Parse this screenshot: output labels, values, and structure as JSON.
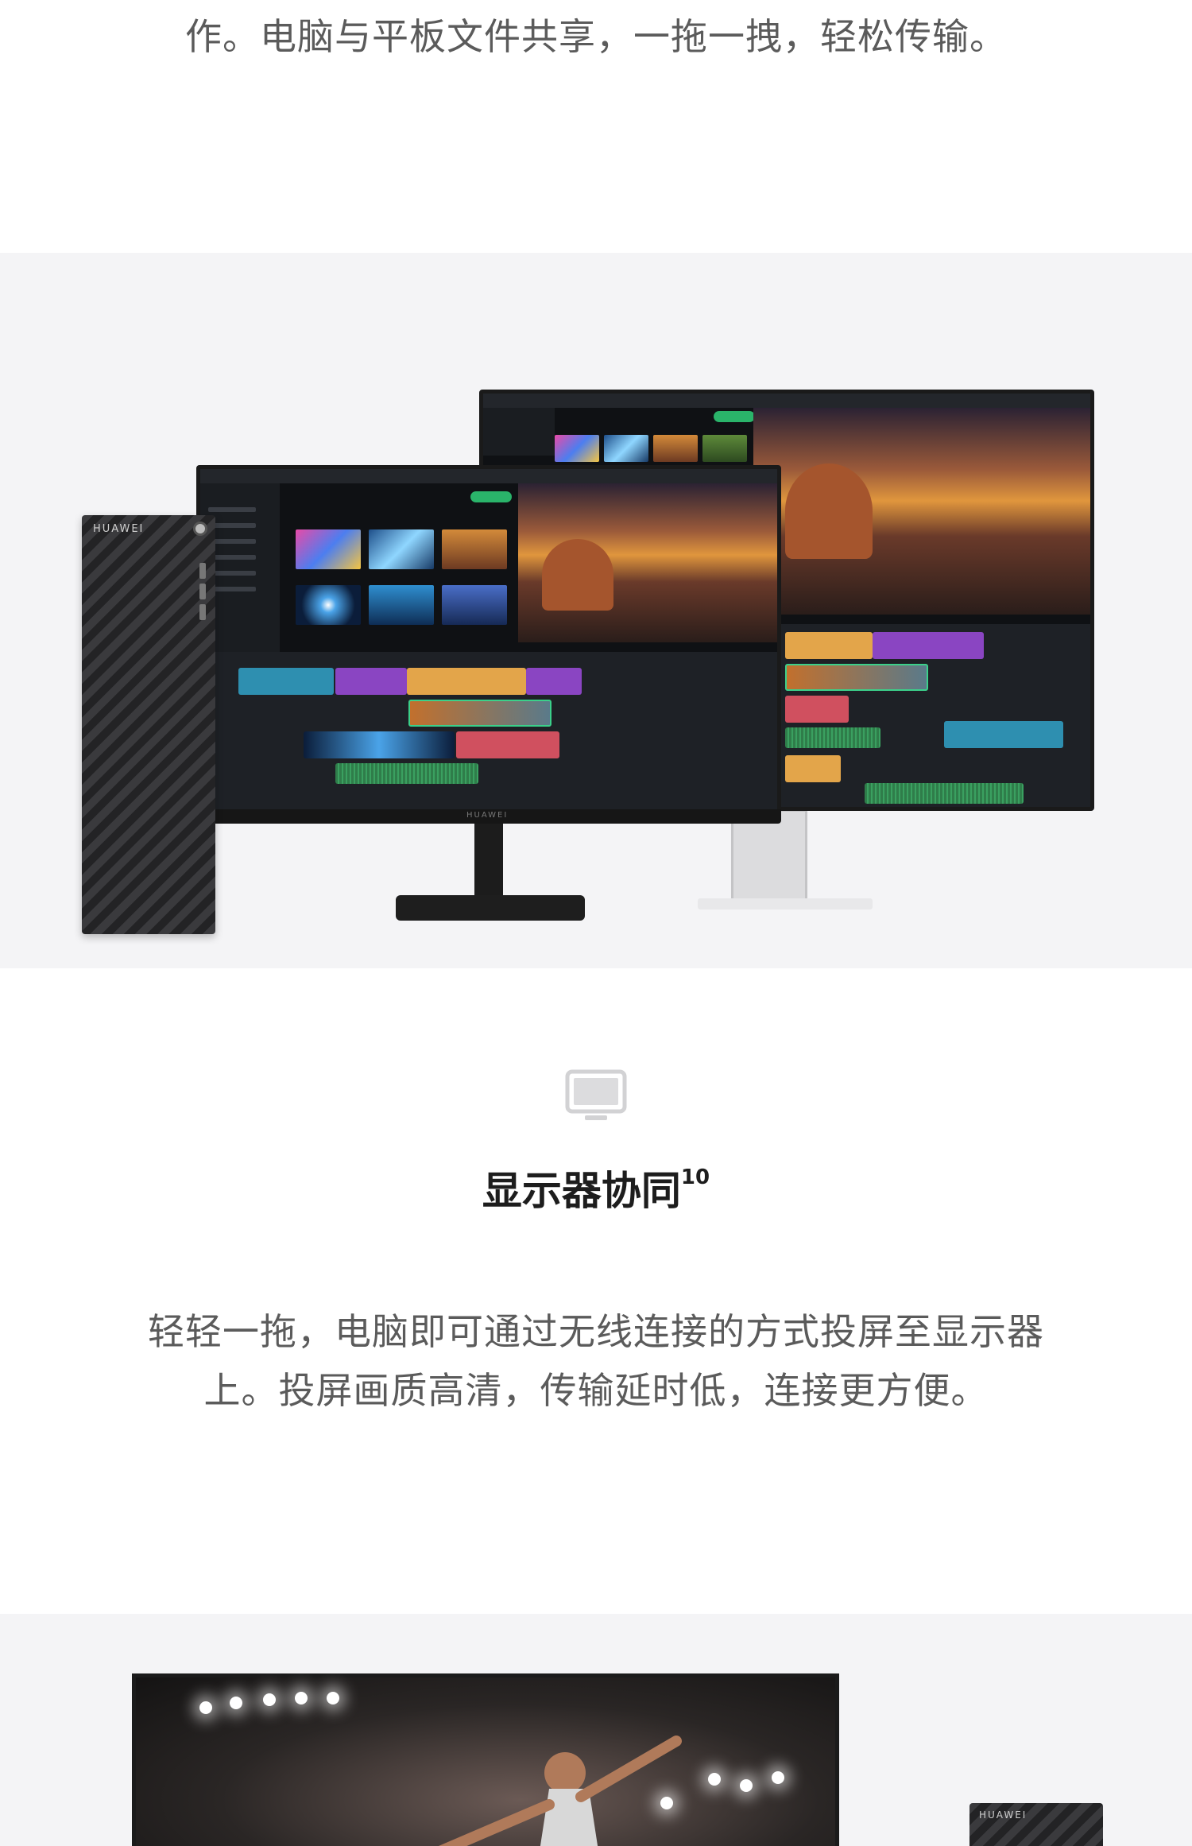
{
  "intro": {
    "line": "作。电脑与平板文件共享，一拖一拽，轻松传输。"
  },
  "hero_top": {
    "tower_brand": "HUAWEI",
    "monitor_brand": "HUAWEI"
  },
  "feature": {
    "icon": "monitor-icon",
    "title": "显示器协同",
    "footnote": "10",
    "description_line1": "轻轻一拖，电脑即可通过无线连接的方式投屏至显示器",
    "description_line2": "上。投屏画质高清，传输延时低，连接更方便。"
  },
  "hero_bottom": {
    "tower_brand": "HUAWEI"
  },
  "colors": {
    "section_bg": "#f4f4f6",
    "text": "#5b5b5b",
    "title": "#1d1d1d"
  }
}
